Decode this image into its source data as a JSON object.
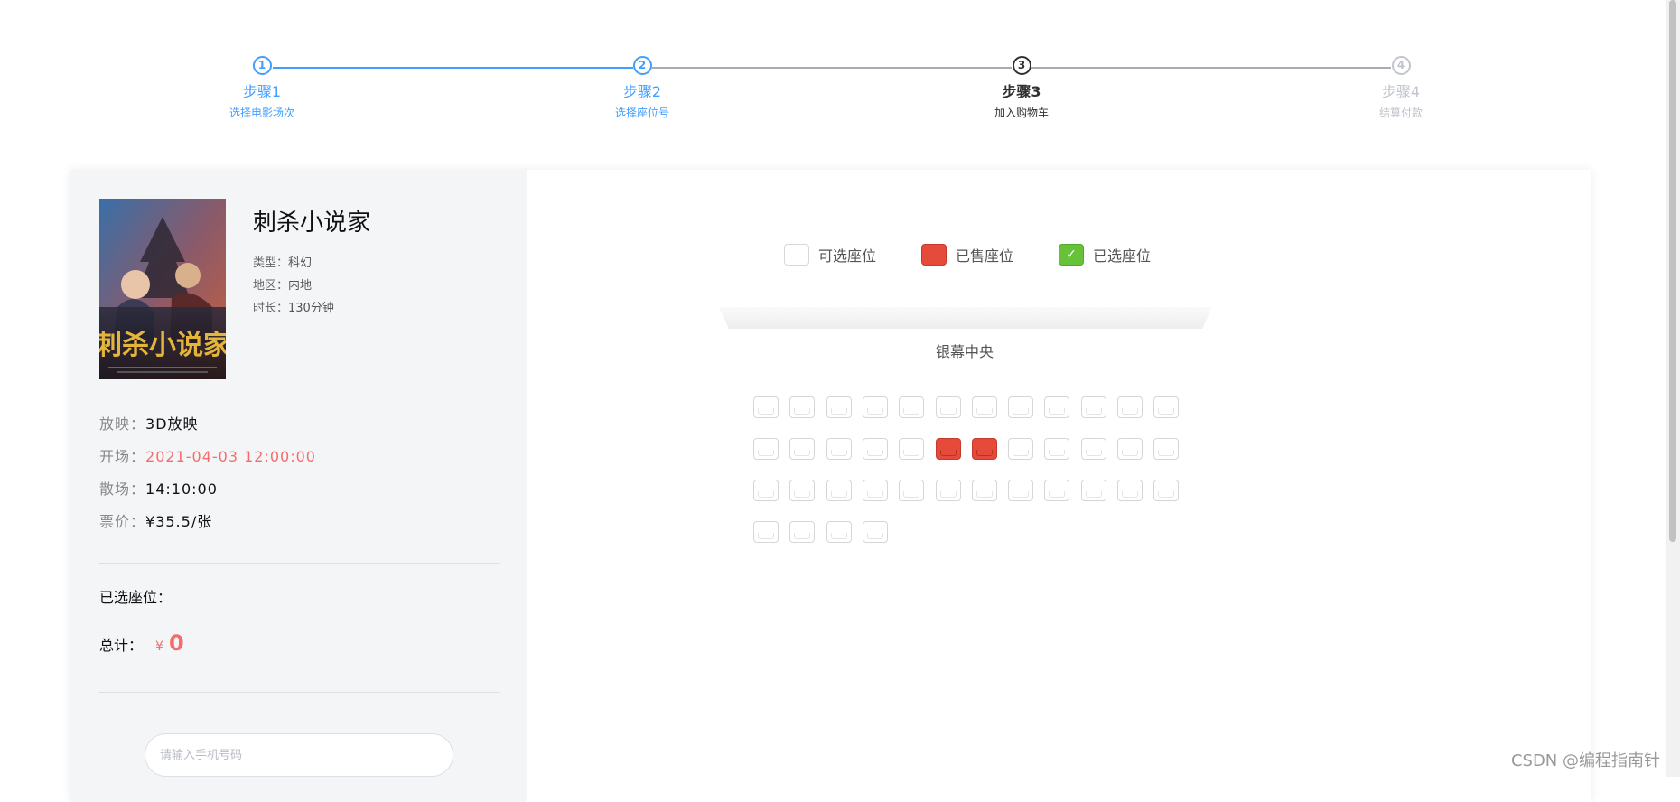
{
  "steps": [
    {
      "number": "1",
      "title": "步骤1",
      "desc": "选择电影场次",
      "status": "done"
    },
    {
      "number": "2",
      "title": "步骤2",
      "desc": "选择座位号",
      "status": "done"
    },
    {
      "number": "3",
      "title": "步骤3",
      "desc": "加入购物车",
      "status": "active"
    },
    {
      "number": "4",
      "title": "步骤4",
      "desc": "结算付款",
      "status": "wait"
    }
  ],
  "movie": {
    "name": "刺杀小说家",
    "genre_label": "类型：",
    "genre": "科幻",
    "region_label": "地区：",
    "region": "内地",
    "duration_label": "时长：",
    "duration": "130分钟"
  },
  "show": {
    "format_label": "放映：",
    "format": "3D放映",
    "start_label": "开场：",
    "start": "2021-04-03 12:00:00",
    "end_label": "散场：",
    "end": "14:10:00",
    "price_label": "票价：",
    "price": "¥35.5/张"
  },
  "order": {
    "selected_label": "已选座位：",
    "total_label": "总计：",
    "currency": "¥",
    "total": "0"
  },
  "phone": {
    "placeholder": "请输入手机号码"
  },
  "legend": {
    "available": "可选座位",
    "sold": "已售座位",
    "selected": "已选座位"
  },
  "screen_label": "银幕中央",
  "seat_rows": [
    [
      "available",
      "available",
      "available",
      "available",
      "available",
      "available",
      "available",
      "available",
      "available",
      "available",
      "available",
      "available"
    ],
    [
      "available",
      "available",
      "available",
      "available",
      "available",
      "sold",
      "sold",
      "available",
      "available",
      "available",
      "available",
      "available"
    ],
    [
      "available",
      "available",
      "available",
      "available",
      "available",
      "available",
      "available",
      "available",
      "available",
      "available",
      "available",
      "available"
    ],
    [
      "available",
      "available",
      "available",
      "available"
    ]
  ],
  "colors": {
    "accent": "#409eff",
    "sold": "#e64a3b",
    "selected": "#67c23a",
    "price_red": "#f56c6c"
  },
  "watermark": "CSDN @编程指南针"
}
